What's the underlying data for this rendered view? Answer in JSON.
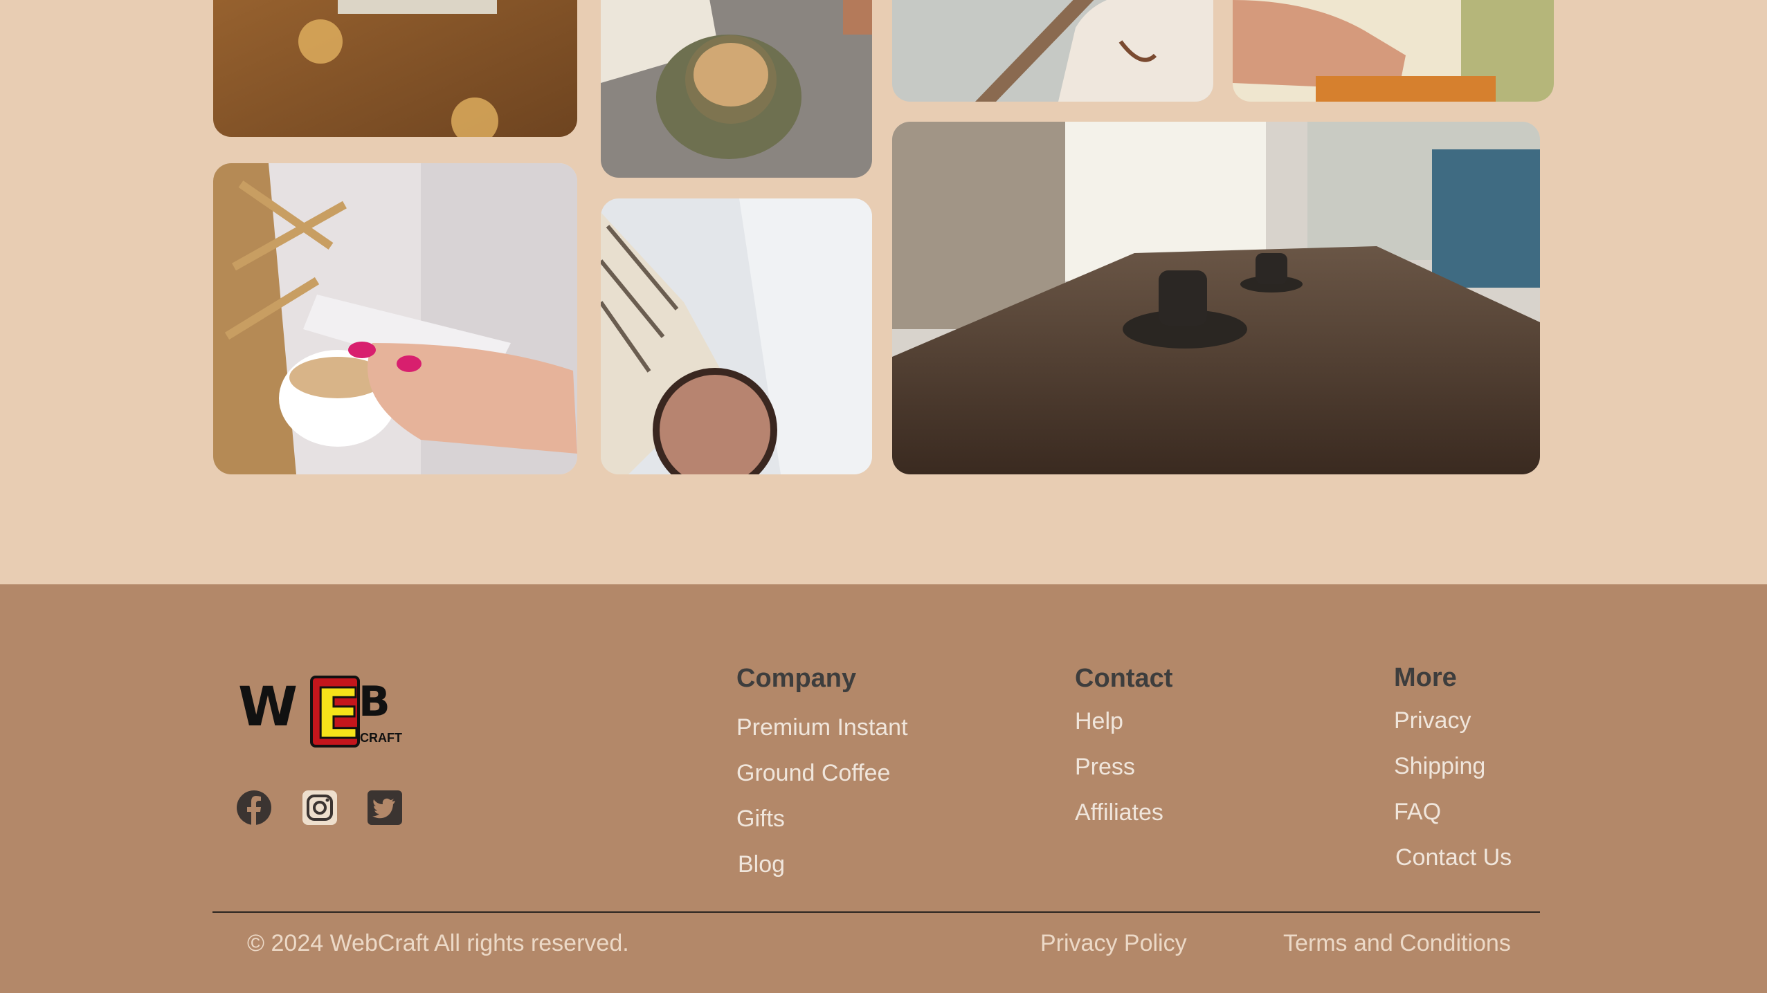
{
  "gallery": {
    "images": [
      {
        "name": "book-on-sweater-photo"
      },
      {
        "name": "coffee-on-book-photo"
      },
      {
        "name": "opening-book-photo"
      },
      {
        "name": "hand-holding-cup-photo"
      },
      {
        "name": "phone-and-coffee-photo"
      },
      {
        "name": "book-and-cocoa-photo"
      },
      {
        "name": "cafe-table-coffee-photo"
      }
    ]
  },
  "footer": {
    "logo": {
      "main": "WEB",
      "sub": "CRAFT"
    },
    "social": [
      "facebook-icon",
      "instagram-icon",
      "twitter-icon"
    ],
    "columns": [
      {
        "title": "Company",
        "links": [
          "Premium Instant",
          "Ground Coffee",
          "Gifts",
          "Blog"
        ]
      },
      {
        "title": "Contact",
        "links": [
          "Help",
          "Press",
          "Affiliates"
        ]
      },
      {
        "title": "More",
        "links": [
          "Privacy",
          "Shipping",
          "FAQ",
          "Contact Us"
        ]
      }
    ],
    "copyright": "© 2024 WebCraft All rights reserved.",
    "legal": [
      "Privacy Policy",
      "Terms and Conditions"
    ]
  },
  "colors": {
    "page_background": "#e8cdb3",
    "footer_background": "#b38869",
    "heading": "#3d3d3d",
    "link": "#f0e6dc",
    "logo_yellow": "#f5e21a",
    "logo_red": "#c4161c"
  }
}
